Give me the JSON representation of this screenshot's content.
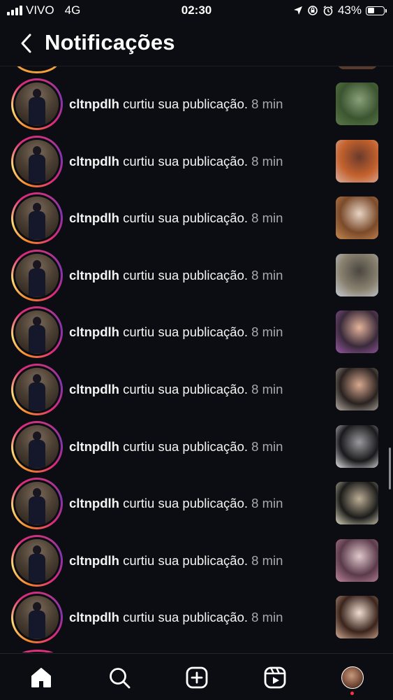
{
  "status_bar": {
    "carrier": "VIVO",
    "network": "4G",
    "time": "02:30",
    "battery_percent_label": "43%",
    "battery_level": 0.43
  },
  "header": {
    "title": "Notificações",
    "back_icon": "chevron-left-icon"
  },
  "notifications": [
    {
      "username": "cltnpdlh",
      "action": "curtiu sua publicação.",
      "time": "8 min",
      "thumb_colors": [
        "#5e7a4a",
        "#3b5530",
        "#8aa07a"
      ]
    },
    {
      "username": "cltnpdlh",
      "action": "curtiu sua publicação.",
      "time": "8 min",
      "thumb_colors": [
        "#d9b0a0",
        "#c4622e",
        "#6b3a2a"
      ]
    },
    {
      "username": "cltnpdlh",
      "action": "curtiu sua publicação.",
      "time": "8 min",
      "thumb_colors": [
        "#c98a52",
        "#7a4a2a",
        "#e7d4c4"
      ]
    },
    {
      "username": "cltnpdlh",
      "action": "curtiu sua publicação.",
      "time": "8 min",
      "thumb_colors": [
        "#c8ccd4",
        "#8a8270",
        "#4a4640"
      ]
    },
    {
      "username": "cltnpdlh",
      "action": "curtiu sua publicação.",
      "time": "8 min",
      "thumb_colors": [
        "#9a5aa8",
        "#3a2a3a",
        "#e4b49a"
      ]
    },
    {
      "username": "cltnpdlh",
      "action": "curtiu sua publicação.",
      "time": "8 min",
      "thumb_colors": [
        "#b8b0a6",
        "#2a2220",
        "#d8a890"
      ]
    },
    {
      "username": "cltnpdlh",
      "action": "curtiu sua publicação.",
      "time": "8 min",
      "thumb_colors": [
        "#e8e8ea",
        "#1a1a1c",
        "#9a9a9e"
      ]
    },
    {
      "username": "cltnpdlh",
      "action": "curtiu sua publicação.",
      "time": "8 min",
      "thumb_colors": [
        "#ddd8c0",
        "#1c1c1a",
        "#bcae96"
      ]
    },
    {
      "username": "cltnpdlh",
      "action": "curtiu sua publicação.",
      "time": "8 min",
      "thumb_colors": [
        "#c08a9c",
        "#5a3a4a",
        "#e0c8cc"
      ]
    },
    {
      "username": "cltnpdlh",
      "action": "curtiu sua publicação.",
      "time": "8 min",
      "thumb_colors": [
        "#d8b098",
        "#3a241c",
        "#f0ddd0"
      ]
    }
  ],
  "tab_bar": {
    "tabs": [
      {
        "name": "home-icon",
        "active": true
      },
      {
        "name": "search-icon",
        "active": false
      },
      {
        "name": "create-post-icon",
        "active": false
      },
      {
        "name": "reels-icon",
        "active": false
      },
      {
        "name": "profile-avatar",
        "active": false
      }
    ],
    "notification_dot_color": "#ff3040"
  },
  "colors": {
    "background": "#0c0d12",
    "text": "#ffffff",
    "secondary_text": "#a8a8ad"
  }
}
